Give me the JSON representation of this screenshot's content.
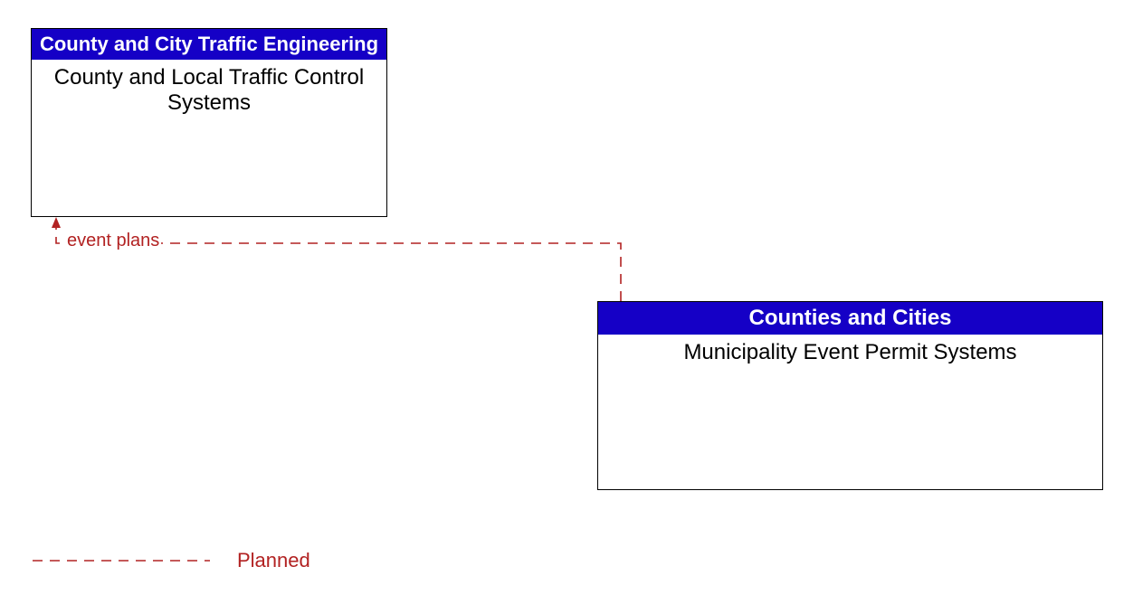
{
  "boxes": {
    "top_left": {
      "header": "County and City Traffic Engineering",
      "body": "County and Local Traffic Control Systems"
    },
    "bottom_right": {
      "header": "Counties and Cities",
      "body": "Municipality Event Permit Systems"
    }
  },
  "flow": {
    "label": "event plans"
  },
  "legend": {
    "planned": "Planned"
  },
  "colors": {
    "header_bg": "#1500c6",
    "connector": "#b22222"
  }
}
